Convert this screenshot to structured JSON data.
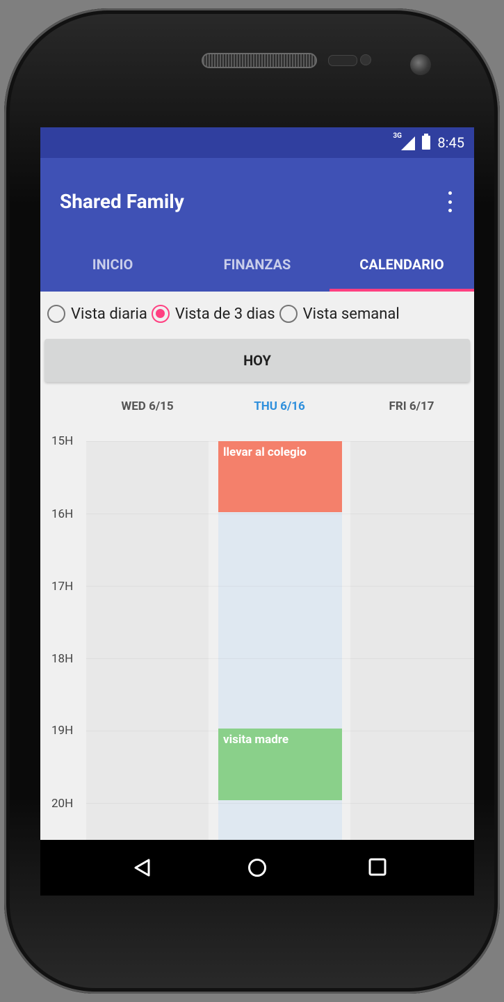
{
  "status_bar": {
    "network": "3G",
    "time": "8:45"
  },
  "app_bar": {
    "title": "Shared Family"
  },
  "tabs": [
    {
      "label": "INICIO",
      "active": false
    },
    {
      "label": "FINANZAS",
      "active": false
    },
    {
      "label": "CALENDARIO",
      "active": true
    }
  ],
  "view_options": [
    {
      "label": "Vista diaria",
      "selected": false
    },
    {
      "label": "Vista de 3 dias",
      "selected": true
    },
    {
      "label": "Vista semanal",
      "selected": false
    }
  ],
  "today_button": {
    "label": "HOY"
  },
  "calendar": {
    "days": [
      {
        "label": "WED 6/15",
        "is_today": false
      },
      {
        "label": "THU 6/16",
        "is_today": true
      },
      {
        "label": "FRI 6/17",
        "is_today": false
      }
    ],
    "hours": [
      "15H",
      "16H",
      "17H",
      "18H",
      "19H",
      "20H"
    ],
    "events": [
      {
        "title": "llevar al colegio",
        "day": "THU 6/16",
        "start": "15H",
        "end": "16H",
        "color": "#f4806b"
      },
      {
        "title": "visita madre",
        "day": "THU 6/16",
        "start": "19H",
        "end": "20H",
        "color": "#8ad08a"
      }
    ]
  },
  "colors": {
    "status_bar": "#303f9f",
    "app_bar": "#3f51b5",
    "accent": "#ff4081",
    "today_header": "#2e8fdc"
  }
}
